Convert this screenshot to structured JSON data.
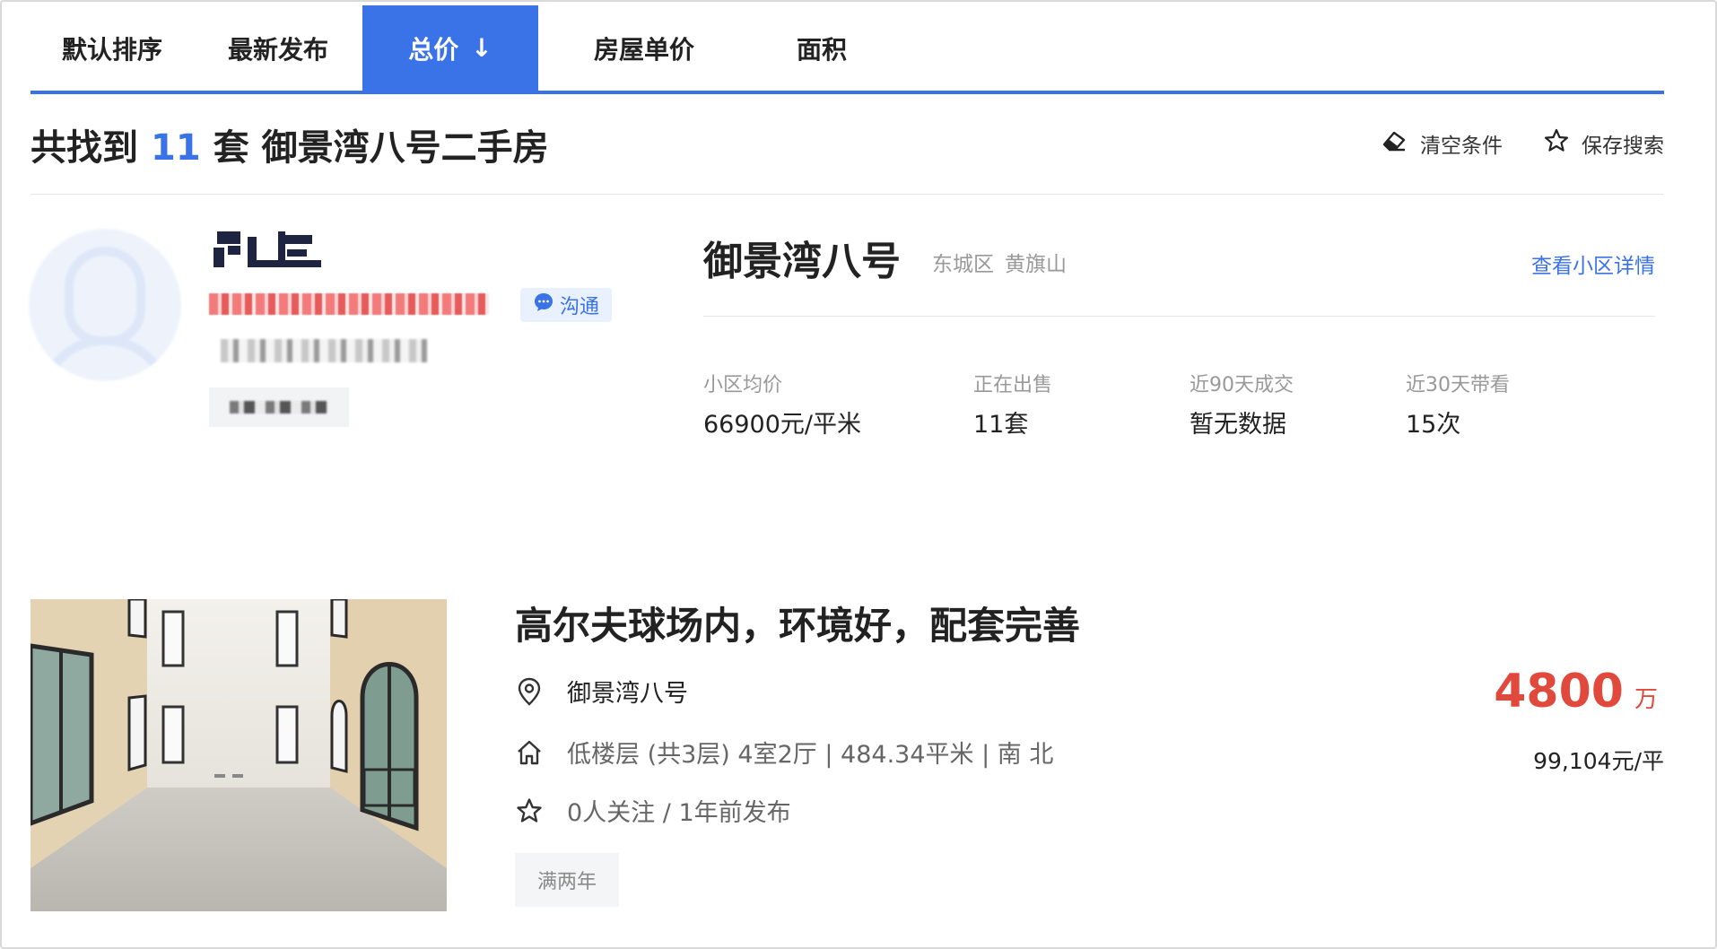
{
  "tabs": [
    {
      "label": "默认排序"
    },
    {
      "label": "最新发布"
    },
    {
      "label": "总价",
      "arrow": "↓"
    },
    {
      "label": "房屋单价"
    },
    {
      "label": "面积"
    }
  ],
  "result": {
    "prefix": "共找到",
    "count": "11",
    "suffix": "套",
    "name": "御景湾八号二手房"
  },
  "actions": {
    "clear_label": "清空条件",
    "clear_icon": "eraser-icon",
    "save_label": "保存搜索",
    "save_icon": "star-outline-icon"
  },
  "agent": {
    "chat_label": "沟通",
    "chat_icon": "chat-bubble-icon"
  },
  "community": {
    "name": "御景湾八号",
    "district": "东城区",
    "area": "黄旗山",
    "detail_link": "查看小区详情",
    "stats": [
      {
        "label": "小区均价",
        "value": "66900元/平米"
      },
      {
        "label": "正在出售",
        "value": "11套"
      },
      {
        "label": "近90天成交",
        "value": "暂无数据"
      },
      {
        "label": "近30天带看",
        "value": "15次"
      }
    ]
  },
  "listing": {
    "title": "高尔夫球场内，环境好，配套完善",
    "location": "御景湾八号",
    "info": "低楼层 (共3层) 4室2厅 | 484.34平米 | 南 北",
    "follow": "0人关注 / 1年前发布",
    "tag": "满两年",
    "price": "4800",
    "price_unit": "万",
    "unit_price": "99,104元/平"
  },
  "colors": {
    "accent": "#3a72e8",
    "price": "#e0493b"
  }
}
